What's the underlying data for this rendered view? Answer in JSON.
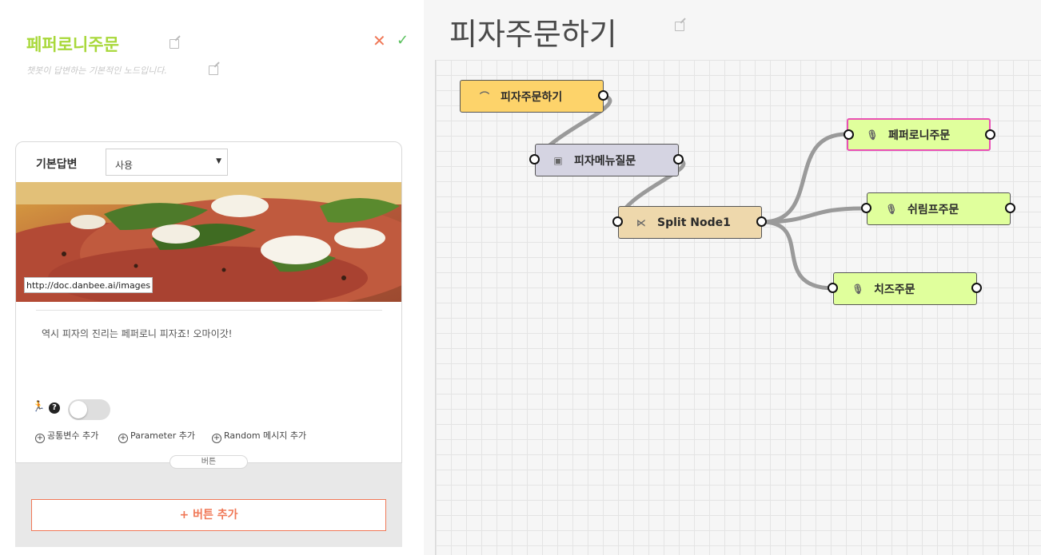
{
  "node_editor": {
    "title": "페퍼로니주문",
    "description": "챗봇이 답변하는 기본적인 노드입니다.",
    "default_answer_label": "기본답변",
    "default_answer_value": "사용",
    "image_url": "http://doc.danbee.ai/images",
    "answer_text": "역시 피자의 진리는 페퍼로니 피자죠! 오마이갓!",
    "help_glyph": "?",
    "add_links": [
      "공통변수 추가",
      "Parameter 추가",
      "Random 메시지 추가"
    ],
    "button_tab": "버튼",
    "add_button": "+ 버튼 추가",
    "colors": {
      "title": "#a8d83a",
      "accent": "#f07857",
      "confirm": "#59c05c"
    }
  },
  "canvas": {
    "scenario_title": "피자주문하기",
    "nodes": [
      {
        "id": "start",
        "label": "피자주문하기",
        "icon": "ear-icon",
        "color": "#fdd36a"
      },
      {
        "id": "menu",
        "label": "피자메뉴질문",
        "icon": "chat-icon",
        "color": "#d5d4e2"
      },
      {
        "id": "split",
        "label": "Split Node1",
        "icon": "split-icon",
        "color": "#eed8ac"
      },
      {
        "id": "pepperoni",
        "label": "페퍼로니주문",
        "icon": "mic-icon",
        "color": "#e0ff9c",
        "selected": true
      },
      {
        "id": "shrimp",
        "label": "쉬림프주문",
        "icon": "mic-icon",
        "color": "#e0ff9c"
      },
      {
        "id": "cheese",
        "label": "치즈주문",
        "icon": "mic-icon",
        "color": "#e0ff9c"
      }
    ]
  }
}
